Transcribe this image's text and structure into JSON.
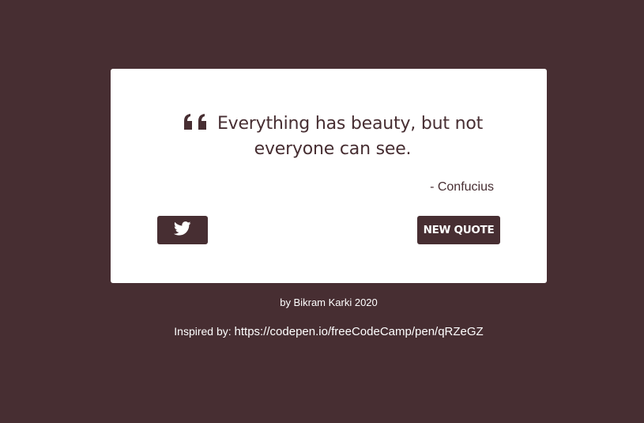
{
  "colors": {
    "background": "#472e32",
    "card": "#ffffff",
    "accent": "#472e32"
  },
  "quote": {
    "icon": "quote-left-icon",
    "text": "Everything has beauty, but not everyone can see.",
    "author": "- Confucius"
  },
  "buttons": {
    "tweet_icon": "twitter-icon",
    "new_quote_label": "NEW QUOTE"
  },
  "footer": {
    "credit": "by Bikram Karki 2020",
    "inspired_label": "Inspired by:",
    "inspired_link": "https://codepen.io/freeCodeCamp/pen/qRZeGZ"
  }
}
